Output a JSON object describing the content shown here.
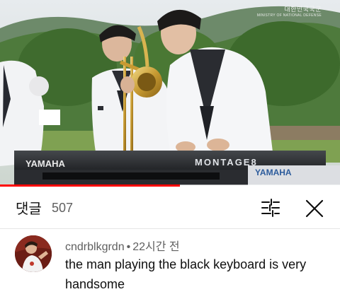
{
  "video": {
    "watermark": "대한민국국군",
    "watermark_sub": "MINISTRY OF NATIONAL DEFENSE",
    "keyboard_brand_left": "YAMAHA",
    "keyboard_model": "MONTAGE8",
    "keyboard_brand_right": "YAMAHA",
    "progress_fraction": 0.53
  },
  "comments_header": {
    "title": "댓글",
    "count": "507",
    "filter_icon": "sort-sliders-icon",
    "close_icon": "close-icon"
  },
  "comment": {
    "author": "cndrblkgrdn",
    "separator": "•",
    "time": "22시간 전",
    "text": "the man playing the black keyboard is very handsome"
  },
  "colors": {
    "progress": "#ff0000",
    "text_primary": "#0f0f0f",
    "text_secondary": "#606060"
  }
}
